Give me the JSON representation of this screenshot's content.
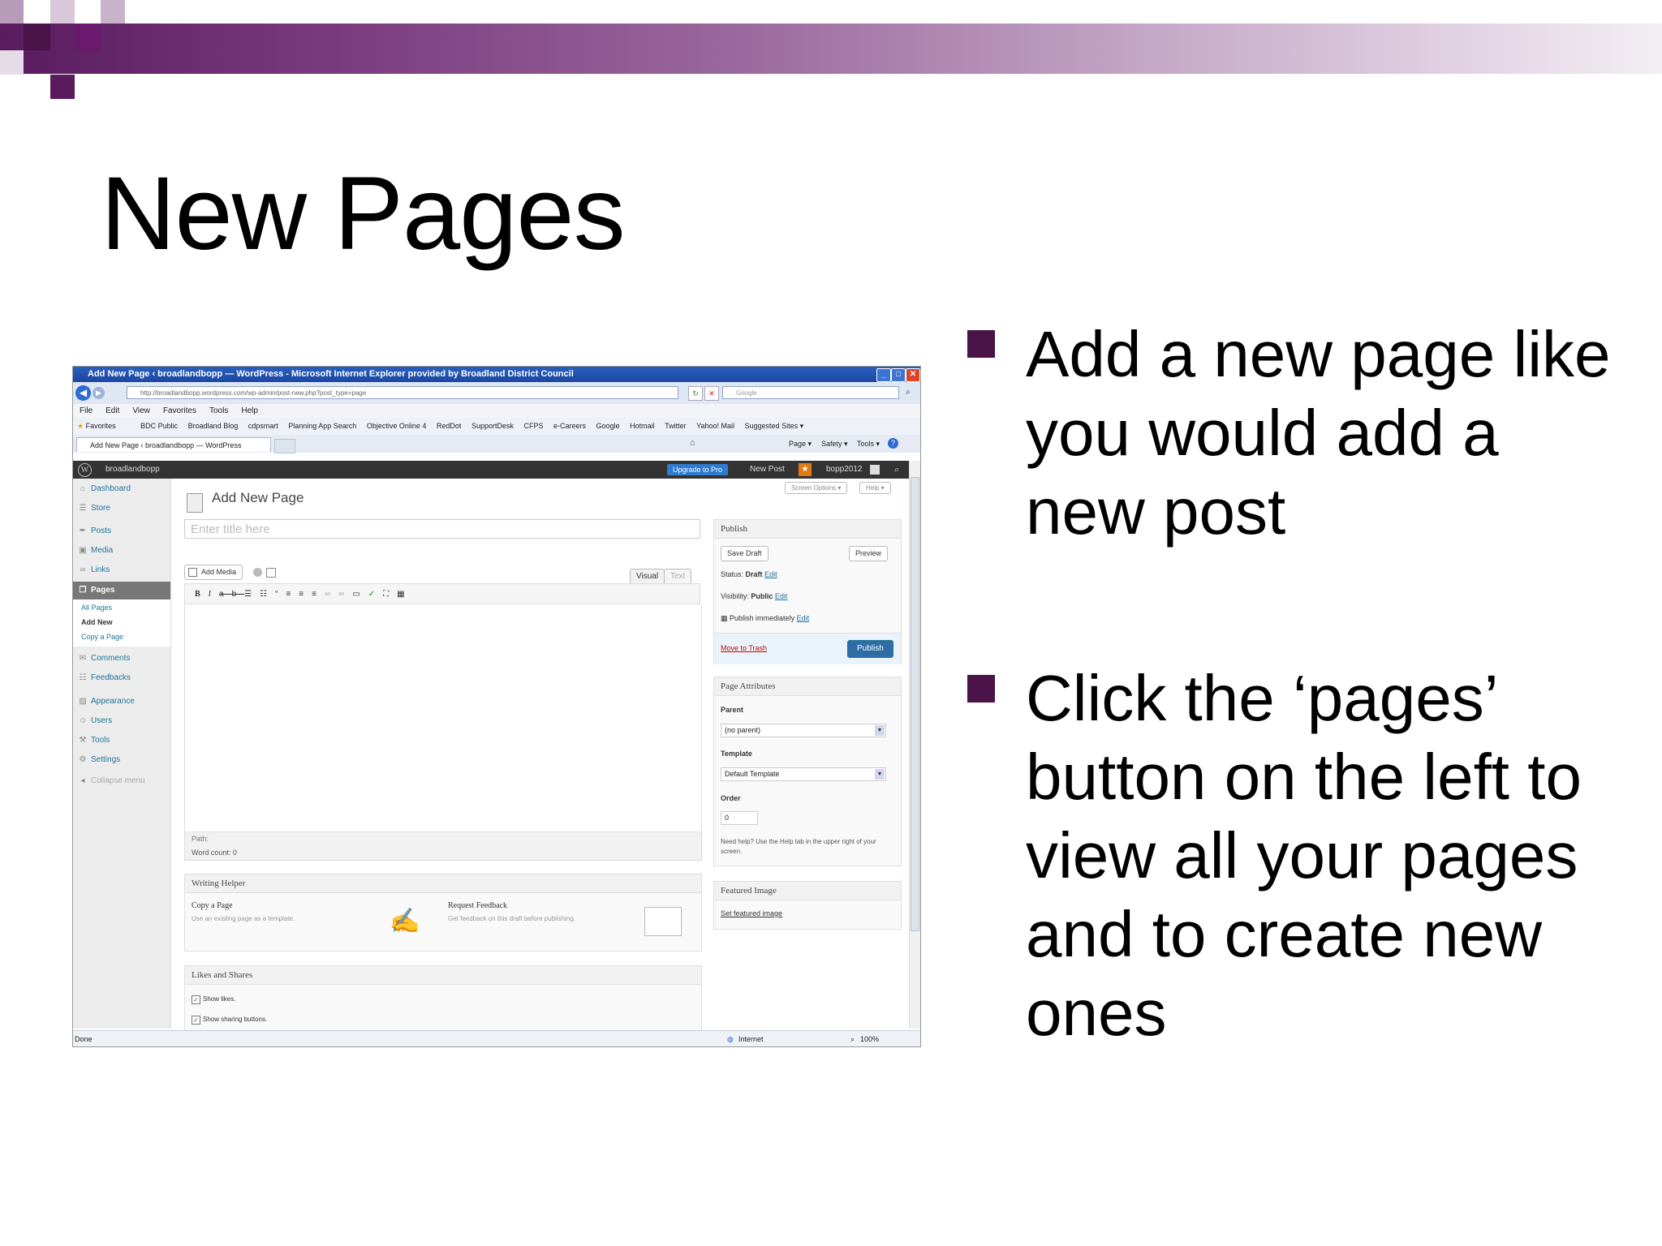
{
  "slide": {
    "title": "New Pages",
    "bullets": [
      "Add a new page like you would add a new post",
      "Click the ‘pages’ button on the left to view all your pages and to create new ones"
    ],
    "accent_color": "#4b1449"
  },
  "browser": {
    "window_title": "Add New Page ‹ broadlandbopp — WordPress - Microsoft Internet Explorer provided by Broadland District Council",
    "address": "http://broadlandbopp.wordpress.com/wp-admin/post-new.php?post_type=page",
    "search_placeholder": "Google",
    "menu": [
      "File",
      "Edit",
      "View",
      "Favorites",
      "Tools",
      "Help"
    ],
    "favorites_label": "Favorites",
    "favorites": [
      "BDC Public",
      "Broadland Blog",
      "cdpsmart",
      "Planning App Search",
      "Objective Online 4",
      "RedDot",
      "SupportDesk",
      "CFPS",
      "e-Careers",
      "Google",
      "Hotmail",
      "Twitter",
      "Yahoo! Mail",
      "Suggested Sites ▾"
    ],
    "tab_title": "Add New Page ‹ broadlandbopp — WordPress",
    "command_items": [
      "Page ▾",
      "Safety ▾",
      "Tools ▾"
    ],
    "status_left": "Done",
    "status_zone": "Internet",
    "status_zoom": "100%"
  },
  "wp": {
    "site_name": "broadlandbopp",
    "upgrade_label": "Upgrade to Pro",
    "new_post_label": "New Post",
    "user": "bopp2012",
    "sidebar": [
      {
        "label": "Dashboard",
        "icon": "dashboard-icon",
        "glyph": "⌂"
      },
      {
        "label": "Store",
        "icon": "cart-icon",
        "glyph": "☰"
      },
      {
        "label": "Posts",
        "icon": "pin-icon",
        "glyph": "✒"
      },
      {
        "label": "Media",
        "icon": "media-icon",
        "glyph": "▣"
      },
      {
        "label": "Links",
        "icon": "link-icon",
        "glyph": "∞"
      },
      {
        "label": "Pages",
        "icon": "pages-icon",
        "glyph": "❐"
      },
      {
        "label": "Comments",
        "icon": "comment-icon",
        "glyph": "✉"
      },
      {
        "label": "Feedbacks",
        "icon": "feedback-icon",
        "glyph": "☷"
      },
      {
        "label": "Appearance",
        "icon": "appearance-icon",
        "glyph": "▨"
      },
      {
        "label": "Users",
        "icon": "users-icon",
        "glyph": "☺"
      },
      {
        "label": "Tools",
        "icon": "tools-icon",
        "glyph": "⚒"
      },
      {
        "label": "Settings",
        "icon": "settings-icon",
        "glyph": "⚙"
      }
    ],
    "pages_submenu": [
      "All Pages",
      "Add New",
      "Copy a Page"
    ],
    "collapse_label": "Collapse menu",
    "screen_options": "Screen Options ▾",
    "help": "Help ▾",
    "page_heading": "Add New Page",
    "title_placeholder": "Enter title here",
    "add_media": "Add Media",
    "tab_visual": "Visual",
    "tab_text": "Text",
    "path_label": "Path:",
    "word_count": "Word count: 0",
    "publish": {
      "heading": "Publish",
      "save_draft": "Save Draft",
      "preview": "Preview",
      "status_label": "Status:",
      "status_value": "Draft",
      "visibility_label": "Visibility:",
      "visibility_value": "Public",
      "schedule": "Publish immediately",
      "edit": "Edit",
      "trash": "Move to Trash",
      "publish_button": "Publish"
    },
    "attributes": {
      "heading": "Page Attributes",
      "parent_label": "Parent",
      "parent_value": "(no parent)",
      "template_label": "Template",
      "template_value": "Default Template",
      "order_label": "Order",
      "order_value": "0",
      "help_text": "Need help? Use the Help tab in the upper right of your screen."
    },
    "featured": {
      "heading": "Featured Image",
      "link": "Set featured image"
    },
    "writing_helper": {
      "heading": "Writing Helper",
      "copy_title": "Copy a Page",
      "copy_desc": "Use an existing page as a template.",
      "feedback_title": "Request Feedback",
      "feedback_desc": "Get feedback on this draft before publishing."
    },
    "likes": {
      "heading": "Likes and Shares",
      "show_likes": "Show likes.",
      "show_sharing": "Show sharing buttons."
    }
  }
}
